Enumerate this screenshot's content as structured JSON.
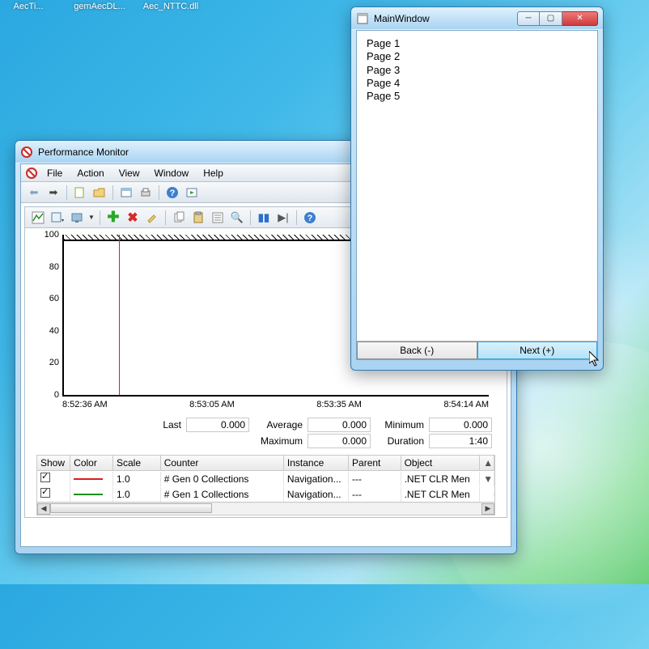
{
  "desktop_icons": [
    "AecTi...",
    "gemAecDL...",
    "Aec_NTTC.dll"
  ],
  "main_window": {
    "title": "MainWindow",
    "pages": [
      "Page 1",
      "Page 2",
      "Page 3",
      "Page 4",
      "Page 5"
    ],
    "back_label": "Back (-)",
    "next_label": "Next (+)"
  },
  "perfmon": {
    "title": "Performance Monitor",
    "menu": [
      "File",
      "Action",
      "View",
      "Window",
      "Help"
    ]
  },
  "chart_data": {
    "type": "line",
    "title": "",
    "xlabel": "",
    "ylabel": "",
    "y_ticks": [
      0,
      20,
      40,
      60,
      80,
      100
    ],
    "ylim": [
      0,
      100
    ],
    "x_ticks": [
      "8:52:36 AM",
      "8:53:05 AM",
      "8:53:35 AM",
      "8:54:14 AM"
    ],
    "current_time_marker": "8:52:44 AM",
    "series": [
      {
        "name": "# Gen 0 Collections",
        "color": "#e21b1b",
        "values": []
      },
      {
        "name": "# Gen 1 Collections",
        "color": "#1b8f1b",
        "values": []
      }
    ],
    "stats": {
      "last_label": "Last",
      "last": "0.000",
      "average_label": "Average",
      "average": "0.000",
      "minimum_label": "Minimum",
      "minimum": "0.000",
      "maximum_label": "Maximum",
      "maximum": "0.000",
      "duration_label": "Duration",
      "duration": "1:40"
    }
  },
  "legend": {
    "headers": {
      "show": "Show",
      "color": "Color",
      "scale": "Scale",
      "counter": "Counter",
      "instance": "Instance",
      "parent": "Parent",
      "object": "Object"
    },
    "rows": [
      {
        "show": true,
        "color": "#e21b1b",
        "scale": "1.0",
        "counter": "# Gen 0 Collections",
        "instance": "Navigation...",
        "parent": "---",
        "object": ".NET CLR Men"
      },
      {
        "show": true,
        "color": "#1b8f1b",
        "scale": "1.0",
        "counter": "# Gen 1 Collections",
        "instance": "Navigation...",
        "parent": "---",
        "object": ".NET CLR Men"
      }
    ]
  }
}
